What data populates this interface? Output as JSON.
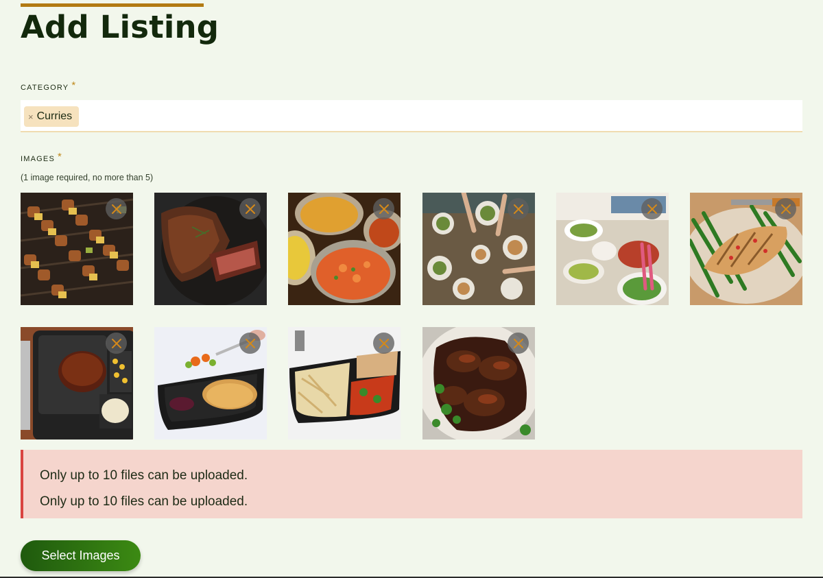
{
  "page": {
    "title": "Add Listing"
  },
  "category": {
    "label": "CATEGORY",
    "required_mark": "*",
    "selected_tags": [
      {
        "label": "Curries",
        "remove_symbol": "×"
      }
    ]
  },
  "images": {
    "label": "IMAGES",
    "required_mark": "*",
    "hint": "(1 image required, no more than 5)",
    "thumbnails": [
      {
        "name": "grilled-kebab-skewers"
      },
      {
        "name": "sliced-steak"
      },
      {
        "name": "indian-curry-dishes"
      },
      {
        "name": "shared-table-spread"
      },
      {
        "name": "dinner-table-salads"
      },
      {
        "name": "grilled-chicken-green-beans"
      },
      {
        "name": "tv-dinner-meatloaf"
      },
      {
        "name": "meal-tray-with-fork"
      },
      {
        "name": "pasta-meal-tray"
      },
      {
        "name": "jerk-chicken-platter"
      }
    ],
    "remove_icon": "close-icon",
    "remove_icon_color": "#d4891a"
  },
  "errors": [
    "Only up to 10 files can be uploaded.",
    "Only up to 10 files can be uploaded."
  ],
  "actions": {
    "select_images_label": "Select Images"
  },
  "colors": {
    "accent": "#b27a12",
    "error_border": "#d94440",
    "error_bg": "#f5d5cd",
    "button_start": "#1f5a0e",
    "button_end": "#3c8a13"
  }
}
